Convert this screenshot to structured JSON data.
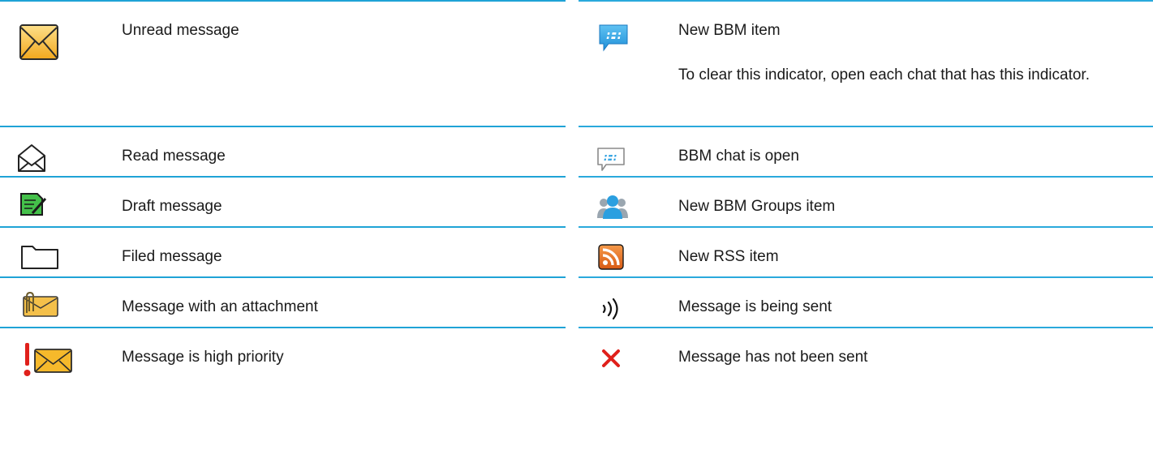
{
  "left_rows": [
    {
      "label": "Unread message",
      "icon": "unread-envelope-icon"
    },
    {
      "label": "Read message",
      "icon": "open-envelope-icon"
    },
    {
      "label": "Draft message",
      "icon": "draft-note-icon"
    },
    {
      "label": "Filed message",
      "icon": "folder-icon"
    },
    {
      "label": "Message with an attachment",
      "icon": "attachment-envelope-icon"
    },
    {
      "label": "Message is high priority",
      "icon": "high-priority-envelope-icon"
    }
  ],
  "right_rows": [
    {
      "label": "New BBM item",
      "note": "To clear this indicator, open each chat that has this indicator.",
      "icon": "bbm-new-item-icon"
    },
    {
      "label": "BBM chat is open",
      "icon": "bbm-chat-open-icon"
    },
    {
      "label": "New BBM Groups item",
      "icon": "bbm-groups-icon"
    },
    {
      "label": "New RSS item",
      "icon": "rss-icon"
    },
    {
      "label": "Message is being sent",
      "icon": "sending-waves-icon"
    },
    {
      "label": "Message has not been sent",
      "icon": "not-sent-x-icon"
    }
  ],
  "colors": {
    "rule": "#2aa9dc",
    "envelope": "#f6b92b",
    "draft": "#3fbf4b",
    "bbm": "#2b9fe0",
    "rss": "#e8742a",
    "error": "#e0201b"
  }
}
